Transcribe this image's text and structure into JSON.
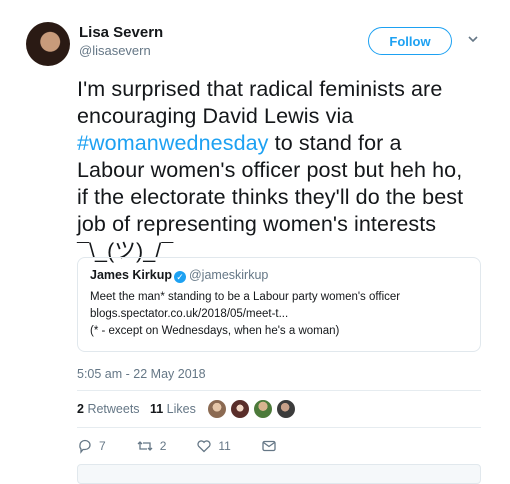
{
  "author": {
    "name": "Lisa Severn",
    "handle": "@lisasevern"
  },
  "follow_label": "Follow",
  "tweet": {
    "lines": [
      "I'm surprised that radical feminists are",
      "encouraging David Lewis via",
      "#womanwednesday",
      " to stand for a",
      "Labour women's officer post but heh ho,",
      "if the electorate thinks they'll do the best",
      "job of representing women's interests",
      "¯\\_(ツ)_/¯"
    ]
  },
  "quoted": {
    "name": "James Kirkup",
    "handle": "@jameskirkup",
    "line1": "Meet the man* standing to be a Labour party women's officer",
    "line2": "blogs.spectator.co.uk/2018/05/meet-t...",
    "line3": "(* - except on Wednesdays, when he's a woman)"
  },
  "timestamp": "5:05 am - 22 May 2018",
  "stats": {
    "retweets_count": "2",
    "retweets_label": "Retweets",
    "likes_count": "11",
    "likes_label": "Likes"
  },
  "actions": {
    "replies": "7",
    "retweets": "2",
    "likes": "11"
  },
  "colors": {
    "accent": "#1da1f2",
    "muted": "#657786"
  },
  "icons": [
    "chevron-down-icon",
    "verified-icon",
    "reply-icon",
    "retweet-icon",
    "like-icon",
    "message-icon"
  ]
}
